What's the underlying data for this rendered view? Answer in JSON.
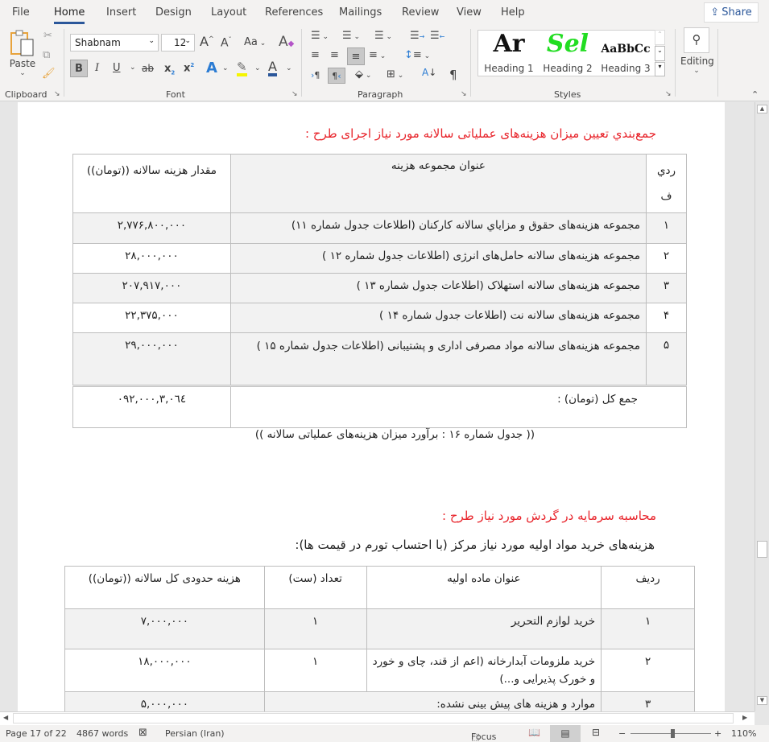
{
  "menu": {
    "tabs": [
      "File",
      "Home",
      "Insert",
      "Design",
      "Layout",
      "References",
      "Mailings",
      "Review",
      "View",
      "Help"
    ],
    "active_tab": "Home",
    "share_label": "Share"
  },
  "ribbon": {
    "clipboard": {
      "paste_label": "Paste",
      "group_label": "Clipboard"
    },
    "font": {
      "font_name": "Shabnam",
      "font_size": "12",
      "group_label": "Font",
      "change_case_label": "Aa"
    },
    "paragraph": {
      "group_label": "Paragraph"
    },
    "styles": {
      "group_label": "Styles",
      "items": [
        {
          "sample": "Ar",
          "name": "Heading 1"
        },
        {
          "sample": "Sel",
          "name": "Heading 2"
        },
        {
          "sample": "AaBbCc",
          "name": "Heading 3"
        }
      ],
      "heading2_color": "#22dd22"
    },
    "editing": {
      "label": "Editing"
    }
  },
  "document": {
    "section1_title": "جمع‌بندي تعيين ميزان هزینه‌های عملیاتی سالانه مورد نياز اجرای طرح :",
    "table1": {
      "headers": {
        "row": "ردي ف",
        "title": "عنوان مجموعه  هزينه",
        "amount": "مقدار هزينه سالانه ((تومان))"
      },
      "rows": [
        {
          "num": "۱",
          "title": "مجموعه هزینه‌های حقوق و مزاياي سالانه كاركنان (اطلاعات جدول شماره ۱۱)",
          "amount": "۲,۷۷۶,۸۰۰,۰۰۰"
        },
        {
          "num": "۲",
          "title": "مجموعه هزینه‌های سالانه حامل‌های انرژی (اطلاعات جدول شماره ۱۲ )",
          "amount": "۲۸,۰۰۰,۰۰۰"
        },
        {
          "num": "۳",
          "title": "مجموعه هزینه‌های سالانه استهلاک (اطلاعات جدول شماره ۱۳ )",
          "amount": "۲۰۷,۹۱۷,۰۰۰"
        },
        {
          "num": "۴",
          "title": "مجموعه هزینه‌های سالانه نت (اطلاعات جدول شماره ۱۴ )",
          "amount": "۲۲,۳۷۵,۰۰۰"
        },
        {
          "num": "۵",
          "title": "مجموعه هزینه‌های سالانه مواد مصرفی اداری و پشتیبانی (اطلاعات جدول شماره ۱۵ )",
          "amount": "۲۹,۰۰۰,۰۰۰"
        }
      ],
      "total_label": "جمع كل (تومان) :",
      "total_value": "۳,۰٦٤,۰۹۲,۰۰۰"
    },
    "table1_caption": "(( جدول شماره ۱۶ : برآورد ميزان هزینه‌های عملیاتی سالانه ))",
    "section2_title": "محاسبه سرمايه در گردش مورد نياز طرح :",
    "section2_intro": "هزینه‌های خرید مواد اولیه مورد نیاز مرکز (با احتساب تورم در قیمت ها):",
    "table2": {
      "headers": {
        "row": "رديف",
        "title": "عنوان ماده اوليه",
        "qty": "تعداد (ست)",
        "cost": "هزينه حدودی كل سالانه ((تومان))"
      },
      "rows": [
        {
          "num": "۱",
          "title": "خرید لوازم التحریر",
          "qty": "۱",
          "cost": "۷,۰۰۰,۰۰۰"
        },
        {
          "num": "۲",
          "title": "خرید ملزومات آبدارخانه (اعم از قند، چای و خورد و خورک پذیرایی و...)",
          "qty": "۱",
          "cost": "۱۸,۰۰۰,۰۰۰"
        },
        {
          "num": "۳",
          "title": "موارد و هزینه های پیش بینی نشده:",
          "qty": "",
          "cost": "۵,۰۰۰,۰۰۰"
        }
      ]
    }
  },
  "status_bar": {
    "page": "Page 17 of 22",
    "words": "4867 words",
    "language": "Persian (Iran)",
    "focus_label": "Focus",
    "zoom_level": "110%",
    "zoom_slider_fraction": 0.52
  },
  "colors": {
    "accent": "#2b579a",
    "heading_red": "#e8232a"
  }
}
